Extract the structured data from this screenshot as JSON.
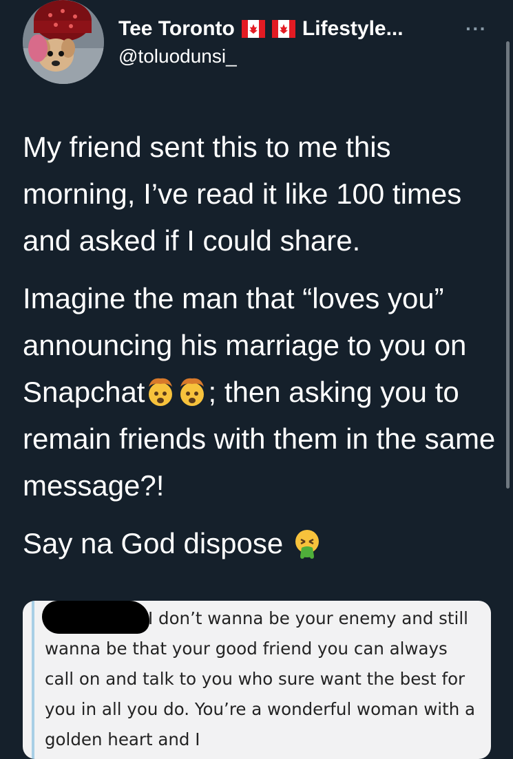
{
  "profile": {
    "display_name": "Tee Toronto",
    "name_suffix": "Lifestyle...",
    "handle": "@toluodunsi_",
    "more_label": "···"
  },
  "tweet": {
    "paragraphs": [
      "My friend sent this to me this morning, I’ve read it like 100 times and asked if I could share.",
      "Imagine the man that “loves you” announcing his marriage to you on Snapchat",
      "; then asking you to remain friends with them in the same message?!",
      "Say na God dispose "
    ]
  },
  "quote": {
    "text": "I don’t wanna be your enemy and still wanna be that your good friend you can always call on and talk to you who sure want the best for you in all you do.  You’re a wonderful woman with a golden heart and I"
  },
  "colors": {
    "background": "#15202b",
    "text": "#ffffff",
    "quote_bg": "#f2f2f3",
    "quote_bar": "#a8cfe6"
  },
  "icons": [
    "canada-flag-icon",
    "exploding-head-emoji",
    "vomiting-face-emoji",
    "more-icon"
  ]
}
